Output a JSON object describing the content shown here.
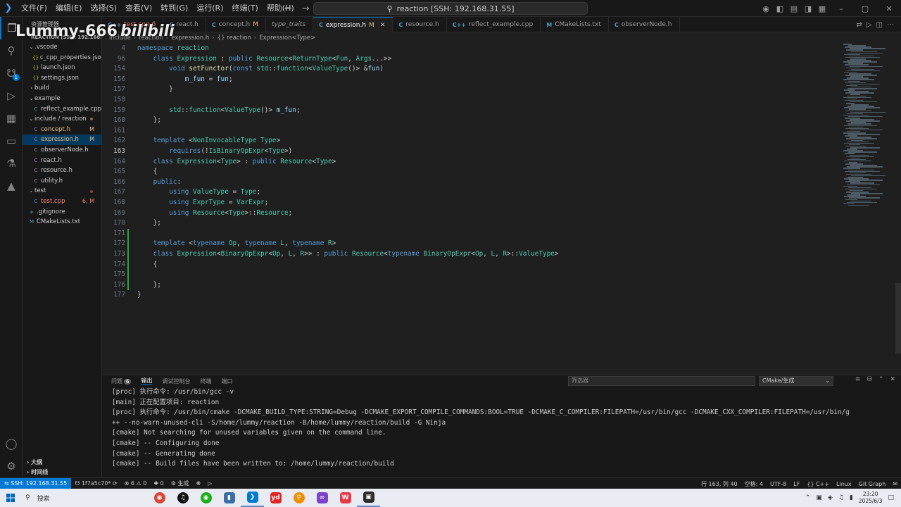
{
  "menu": [
    "文件(F)",
    "编辑(E)",
    "选择(S)",
    "查看(V)",
    "转到(G)",
    "运行(R)",
    "终端(T)",
    "帮助(H)"
  ],
  "command_center": "reaction [SSH: 192.168.31.55]",
  "sidebar": {
    "title": "资源管理器",
    "root": "REACTION [SSH: 192.168...",
    "items": [
      {
        "label": ".vscode",
        "kind": "folder-open",
        "depth": 1
      },
      {
        "label": "c_cpp_properties.json",
        "kind": "json",
        "depth": 2
      },
      {
        "label": "launch.json",
        "kind": "json",
        "depth": 2
      },
      {
        "label": "settings.json",
        "kind": "json",
        "depth": 2
      },
      {
        "label": "build",
        "kind": "folder",
        "depth": 1
      },
      {
        "label": "example",
        "kind": "folder-open",
        "depth": 1
      },
      {
        "label": "reflect_example.cpp",
        "kind": "cpp",
        "depth": 2
      },
      {
        "label": "include / reaction",
        "kind": "folder-open",
        "depth": 1,
        "status": "dot"
      },
      {
        "label": "concept.h",
        "kind": "h",
        "depth": 2,
        "status": "M"
      },
      {
        "label": "expression.h",
        "kind": "h",
        "depth": 2,
        "status": "M",
        "selected": true
      },
      {
        "label": "observerNode.h",
        "kind": "h",
        "depth": 2
      },
      {
        "label": "react.h",
        "kind": "h",
        "depth": 2
      },
      {
        "label": "resource.h",
        "kind": "h",
        "depth": 2
      },
      {
        "label": "utility.h",
        "kind": "h",
        "depth": 2
      },
      {
        "label": "test",
        "kind": "folder-open",
        "depth": 1,
        "status": "dot-err"
      },
      {
        "label": "test.cpp",
        "kind": "cpp",
        "depth": 2,
        "status": "6, M",
        "error": true
      },
      {
        "label": ".gitignore",
        "kind": "git",
        "depth": 1
      },
      {
        "label": "CMakeLists.txt",
        "kind": "cmake",
        "depth": 1
      }
    ],
    "outline": "大纲",
    "timeline": "时间线"
  },
  "tabs": [
    {
      "label": "test.cpp 6",
      "icon": "C++",
      "active": false
    },
    {
      "label": "react.h",
      "icon": "C",
      "active": false
    },
    {
      "label": "concept.h",
      "icon": "C",
      "mark": "M",
      "active": false
    },
    {
      "label": "type_traits",
      "icon": "",
      "active": false,
      "italic": true
    },
    {
      "label": "expression.h",
      "icon": "C",
      "mark": "M",
      "active": true
    },
    {
      "label": "resource.h",
      "icon": "C",
      "active": false
    },
    {
      "label": "reflect_example.cpp",
      "icon": "C++",
      "active": false
    },
    {
      "label": "CMakeLists.txt",
      "icon": "M",
      "active": false
    },
    {
      "label": "observerNode.h",
      "icon": "C",
      "active": false
    }
  ],
  "breadcrumb": [
    "include",
    "reaction",
    "expression.h",
    "{} reaction",
    "Expression<Type>"
  ],
  "code_lines": [
    {
      "n": "4",
      "text": "namespace reaction"
    },
    {
      "n": "96",
      "text": "    class Expression : public Resource<ReturnType<Fun, Args...>>"
    },
    {
      "n": "154",
      "text": "        void setFunctor(const std::function<ValueType()> &fun)"
    },
    {
      "n": "156",
      "text": "            m_fun = fun;"
    },
    {
      "n": "157",
      "text": "        }"
    },
    {
      "n": "158",
      "text": ""
    },
    {
      "n": "159",
      "text": "        std::function<ValueType()> m_fun;"
    },
    {
      "n": "160",
      "text": "    };"
    },
    {
      "n": "161",
      "text": ""
    },
    {
      "n": "162",
      "text": "    template <NonInvocableType Type>"
    },
    {
      "n": "163",
      "text": "        requires(!IsBinaryOpExpr<Type>)"
    },
    {
      "n": "164",
      "text": "    class Expression<Type> : public Resource<Type>"
    },
    {
      "n": "165",
      "text": "    {"
    },
    {
      "n": "166",
      "text": "    public:"
    },
    {
      "n": "167",
      "text": "        using ValueType = Type;"
    },
    {
      "n": "168",
      "text": "        using ExprType = VarExpr;"
    },
    {
      "n": "169",
      "text": "        using Resource<Type>::Resource;"
    },
    {
      "n": "170",
      "text": "    };"
    },
    {
      "n": "171",
      "text": ""
    },
    {
      "n": "172",
      "text": "    template <typename Op, typename L, typename R>"
    },
    {
      "n": "173",
      "text": "    class Expression<BinaryOpExpr<Op, L, R>> : public Resource<typename BinaryOpExpr<Op, L, R>::ValueType>"
    },
    {
      "n": "174",
      "text": "    {"
    },
    {
      "n": "175",
      "text": ""
    },
    {
      "n": "176",
      "text": "    };"
    },
    {
      "n": "177",
      "text": "}"
    }
  ],
  "panel": {
    "tabs": [
      "问题",
      "输出",
      "调试控制台",
      "终端",
      "端口"
    ],
    "problems_count": "6",
    "filter_placeholder": "筛选器",
    "output_channel": "CMake/生成",
    "output_lines": [
      "[proc] 执行命令: /usr/bin/gcc -v",
      "[main] 正在配置项目: reaction",
      "[proc] 执行命令: /usr/bin/cmake -DCMAKE_BUILD_TYPE:STRING=Debug -DCMAKE_EXPORT_COMPILE_COMMANDS:BOOL=TRUE -DCMAKE_C_COMPILER:FILEPATH=/usr/bin/gcc -DCMAKE_CXX_COMPILER:FILEPATH=/usr/bin/g",
      "++ --no-warn-unused-cli -S/home/lummy/reaction -B/home/lummy/reaction/build -G Ninja",
      "[cmake] Not searching for unused variables given on the command line.",
      "[cmake] -- Configuring done",
      "[cmake] -- Generating done",
      "[cmake] -- Build files have been written to: /home/lummy/reaction/build"
    ]
  },
  "statusbar": {
    "remote": "SSH: 192.168.31.55",
    "branch": "1f7a5c70*",
    "errors": "6",
    "warnings": "0",
    "ports": "0",
    "build": "生成",
    "position": "行 163, 列 40",
    "spaces": "空格: 4",
    "encoding": "UTF-8",
    "eol": "LF",
    "language": "C++",
    "platform": "Linux",
    "git_graph": "Git Graph"
  },
  "taskbar": {
    "search": "搜索",
    "time": "23:20",
    "date": "2025/6/3"
  },
  "watermark": {
    "text": "Lummy-666",
    "brand": "bilibili"
  }
}
